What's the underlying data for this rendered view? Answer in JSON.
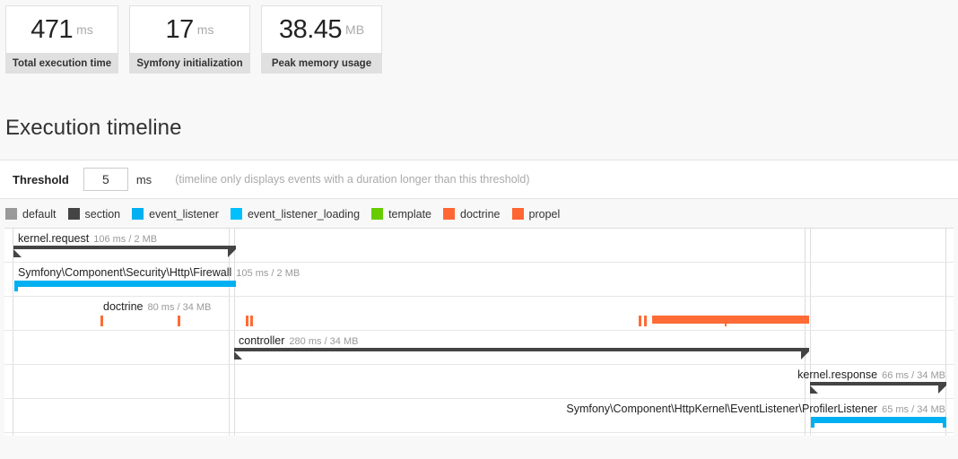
{
  "cards": [
    {
      "value": "471",
      "unit": "ms",
      "label": "Total execution time"
    },
    {
      "value": "17",
      "unit": "ms",
      "label": "Symfony initialization"
    },
    {
      "value": "38.45",
      "unit": "MB",
      "label": "Peak memory usage"
    }
  ],
  "section": {
    "title": "Execution timeline"
  },
  "threshold": {
    "label": "Threshold",
    "value": "5",
    "unit": "ms",
    "hint": "(timeline only displays events with a duration longer than this threshold)"
  },
  "legend": [
    {
      "label": "default",
      "color": "#999999"
    },
    {
      "label": "section",
      "color": "#444444"
    },
    {
      "label": "event_listener",
      "color": "#00b0f0"
    },
    {
      "label": "event_listener_loading",
      "color": "#00c0ff"
    },
    {
      "label": "template",
      "color": "#66cc00"
    },
    {
      "label": "doctrine",
      "color": "#ff6633"
    },
    {
      "label": "propel",
      "color": "#ff6633"
    }
  ],
  "timeline": {
    "rows": [
      {
        "name": "kernel.request",
        "label": "kernel.request",
        "meta": "106 ms / 2 MB",
        "type": "section"
      },
      {
        "name": "firewall",
        "label": "Symfony\\Component\\Security\\Http\\Firewall",
        "meta": "105 ms / 2 MB",
        "type": "event_listener"
      },
      {
        "name": "doctrine",
        "label": "doctrine",
        "meta": "80 ms / 34 MB",
        "type": "doctrine"
      },
      {
        "name": "controller",
        "label": "controller",
        "meta": "280 ms / 34 MB",
        "type": "section"
      },
      {
        "name": "kernel.response",
        "label": "kernel.response",
        "meta": "66 ms / 34 MB",
        "type": "section"
      },
      {
        "name": "profiler-listener",
        "label": "Symfony\\Component\\HttpKernel\\EventListener\\ProfilerListener",
        "meta": "65 ms / 34 MB",
        "type": "event_listener"
      }
    ]
  }
}
